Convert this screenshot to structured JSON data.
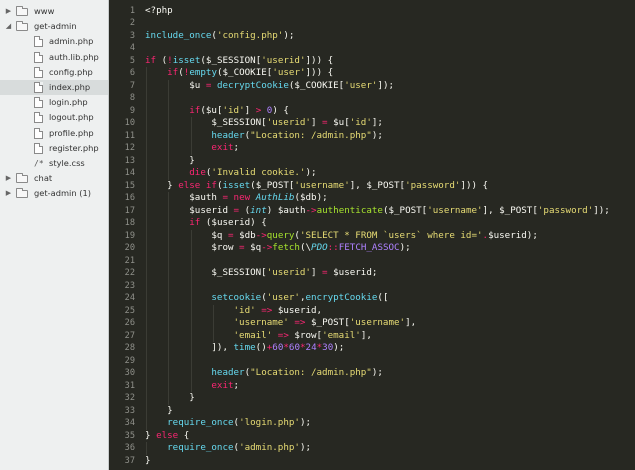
{
  "sidebar": {
    "items": [
      {
        "label": "www",
        "type": "folder",
        "expanded": false,
        "depth": 0,
        "selected": false
      },
      {
        "label": "get-admin",
        "type": "folder",
        "expanded": true,
        "depth": 0,
        "selected": false
      },
      {
        "label": "admin.php",
        "type": "file",
        "depth": 1,
        "selected": false
      },
      {
        "label": "auth.lib.php",
        "type": "file",
        "depth": 1,
        "selected": false
      },
      {
        "label": "config.php",
        "type": "file",
        "depth": 1,
        "selected": false
      },
      {
        "label": "index.php",
        "type": "file",
        "depth": 1,
        "selected": true
      },
      {
        "label": "login.php",
        "type": "file",
        "depth": 1,
        "selected": false
      },
      {
        "label": "logout.php",
        "type": "file",
        "depth": 1,
        "selected": false
      },
      {
        "label": "profile.php",
        "type": "file",
        "depth": 1,
        "selected": false
      },
      {
        "label": "register.php",
        "type": "file",
        "depth": 1,
        "selected": false
      },
      {
        "label": "style.css",
        "type": "css",
        "depth": 1,
        "selected": false
      },
      {
        "label": "chat",
        "type": "folder",
        "expanded": false,
        "depth": 0,
        "selected": false
      },
      {
        "label": "get-admin (1)",
        "type": "folder",
        "expanded": false,
        "depth": 0,
        "selected": false
      }
    ]
  },
  "editor": {
    "theme": {
      "background": "#272822",
      "sidebar_background": "#eef0f0",
      "selected_row": "#d8dcdc"
    },
    "lines": [
      [
        [
          "v",
          "<?php"
        ]
      ],
      [],
      [
        [
          "f",
          "include_once"
        ],
        [
          "v",
          "("
        ],
        [
          "s",
          "'config.php'"
        ],
        [
          "v",
          ");"
        ]
      ],
      [],
      [
        [
          "k",
          "if"
        ],
        [
          "v",
          " ("
        ],
        [
          "o",
          "!"
        ],
        [
          "f",
          "isset"
        ],
        [
          "v",
          "($_SESSION["
        ],
        [
          "s",
          "'userid'"
        ],
        [
          "v",
          "])) {"
        ]
      ],
      [
        [
          "v",
          "    "
        ],
        [
          "k",
          "if"
        ],
        [
          "v",
          "("
        ],
        [
          "o",
          "!"
        ],
        [
          "f",
          "empty"
        ],
        [
          "v",
          "($_COOKIE["
        ],
        [
          "s",
          "'user'"
        ],
        [
          "v",
          "])) {"
        ]
      ],
      [
        [
          "v",
          "        $u "
        ],
        [
          "o",
          "="
        ],
        [
          "v",
          " "
        ],
        [
          "f",
          "decryptCookie"
        ],
        [
          "v",
          "($_COOKIE["
        ],
        [
          "s",
          "'user'"
        ],
        [
          "v",
          "]);"
        ]
      ],
      [],
      [
        [
          "v",
          "        "
        ],
        [
          "k",
          "if"
        ],
        [
          "v",
          "($u["
        ],
        [
          "s",
          "'id'"
        ],
        [
          "v",
          "] "
        ],
        [
          "o",
          ">"
        ],
        [
          "v",
          " "
        ],
        [
          "n",
          "0"
        ],
        [
          "v",
          ") {"
        ]
      ],
      [
        [
          "v",
          "            $_SESSION["
        ],
        [
          "s",
          "'userid'"
        ],
        [
          "v",
          "] "
        ],
        [
          "o",
          "="
        ],
        [
          "v",
          " $u["
        ],
        [
          "s",
          "'id'"
        ],
        [
          "v",
          "];"
        ]
      ],
      [
        [
          "v",
          "            "
        ],
        [
          "f",
          "header"
        ],
        [
          "v",
          "("
        ],
        [
          "s",
          "\"Location: /admin.php\""
        ],
        [
          "v",
          ");"
        ]
      ],
      [
        [
          "v",
          "            "
        ],
        [
          "k",
          "exit"
        ],
        [
          "v",
          ";"
        ]
      ],
      [
        [
          "v",
          "        }"
        ]
      ],
      [
        [
          "v",
          "        "
        ],
        [
          "k",
          "die"
        ],
        [
          "v",
          "("
        ],
        [
          "s",
          "'Invalid cookie.'"
        ],
        [
          "v",
          ");"
        ]
      ],
      [
        [
          "v",
          "    } "
        ],
        [
          "k",
          "else if"
        ],
        [
          "v",
          "("
        ],
        [
          "f",
          "isset"
        ],
        [
          "v",
          "($_POST["
        ],
        [
          "s",
          "'username'"
        ],
        [
          "v",
          "], $_POST["
        ],
        [
          "s",
          "'password'"
        ],
        [
          "v",
          "])) {"
        ]
      ],
      [
        [
          "v",
          "        $auth "
        ],
        [
          "o",
          "="
        ],
        [
          "v",
          " "
        ],
        [
          "k",
          "new"
        ],
        [
          "v",
          " "
        ],
        [
          "i",
          "AuthLib"
        ],
        [
          "v",
          "($db);"
        ]
      ],
      [
        [
          "v",
          "        $userid "
        ],
        [
          "o",
          "="
        ],
        [
          "v",
          " ("
        ],
        [
          "i",
          "int"
        ],
        [
          "v",
          ") $auth"
        ],
        [
          "o",
          "->"
        ],
        [
          "g",
          "authenticate"
        ],
        [
          "v",
          "($_POST["
        ],
        [
          "s",
          "'username'"
        ],
        [
          "v",
          "], $_POST["
        ],
        [
          "s",
          "'password'"
        ],
        [
          "v",
          "]);"
        ]
      ],
      [
        [
          "v",
          "        "
        ],
        [
          "k",
          "if"
        ],
        [
          "v",
          " ($userid) {"
        ]
      ],
      [
        [
          "v",
          "            $q "
        ],
        [
          "o",
          "="
        ],
        [
          "v",
          " $db"
        ],
        [
          "o",
          "->"
        ],
        [
          "g",
          "query"
        ],
        [
          "v",
          "("
        ],
        [
          "s",
          "'SELECT * FROM `users` where id='"
        ],
        [
          "o",
          "."
        ],
        [
          "v",
          "$userid);"
        ]
      ],
      [
        [
          "v",
          "            $row "
        ],
        [
          "o",
          "="
        ],
        [
          "v",
          " $q"
        ],
        [
          "o",
          "->"
        ],
        [
          "g",
          "fetch"
        ],
        [
          "v",
          "(\\"
        ],
        [
          "i",
          "PDO"
        ],
        [
          "o",
          "::"
        ],
        [
          "c",
          "FETCH_ASSOC"
        ],
        [
          "v",
          ");"
        ]
      ],
      [],
      [
        [
          "v",
          "            $_SESSION["
        ],
        [
          "s",
          "'userid'"
        ],
        [
          "v",
          "] "
        ],
        [
          "o",
          "="
        ],
        [
          "v",
          " $userid;"
        ]
      ],
      [],
      [
        [
          "v",
          "            "
        ],
        [
          "f",
          "setcookie"
        ],
        [
          "v",
          "("
        ],
        [
          "s",
          "'user'"
        ],
        [
          "v",
          ","
        ],
        [
          "f",
          "encryptCookie"
        ],
        [
          "v",
          "(["
        ]
      ],
      [
        [
          "v",
          "                "
        ],
        [
          "s",
          "'id'"
        ],
        [
          "v",
          " "
        ],
        [
          "o",
          "=>"
        ],
        [
          "v",
          " $userid,"
        ]
      ],
      [
        [
          "v",
          "                "
        ],
        [
          "s",
          "'username'"
        ],
        [
          "v",
          " "
        ],
        [
          "o",
          "=>"
        ],
        [
          "v",
          " $_POST["
        ],
        [
          "s",
          "'username'"
        ],
        [
          "v",
          "],"
        ]
      ],
      [
        [
          "v",
          "                "
        ],
        [
          "s",
          "'email'"
        ],
        [
          "v",
          " "
        ],
        [
          "o",
          "=>"
        ],
        [
          "v",
          " $row["
        ],
        [
          "s",
          "'email'"
        ],
        [
          "v",
          "],"
        ]
      ],
      [
        [
          "v",
          "            ]), "
        ],
        [
          "f",
          "time"
        ],
        [
          "v",
          "()"
        ],
        [
          "o",
          "+"
        ],
        [
          "n",
          "60"
        ],
        [
          "o",
          "*"
        ],
        [
          "n",
          "60"
        ],
        [
          "o",
          "*"
        ],
        [
          "n",
          "24"
        ],
        [
          "o",
          "*"
        ],
        [
          "n",
          "30"
        ],
        [
          "v",
          ");"
        ]
      ],
      [],
      [
        [
          "v",
          "            "
        ],
        [
          "f",
          "header"
        ],
        [
          "v",
          "("
        ],
        [
          "s",
          "\"Location: /admin.php\""
        ],
        [
          "v",
          ");"
        ]
      ],
      [
        [
          "v",
          "            "
        ],
        [
          "k",
          "exit"
        ],
        [
          "v",
          ";"
        ]
      ],
      [
        [
          "v",
          "        }"
        ]
      ],
      [
        [
          "v",
          "    }"
        ]
      ],
      [
        [
          "v",
          "    "
        ],
        [
          "f",
          "require_once"
        ],
        [
          "v",
          "("
        ],
        [
          "s",
          "'login.php'"
        ],
        [
          "v",
          ");"
        ]
      ],
      [
        [
          "v",
          "} "
        ],
        [
          "k",
          "else"
        ],
        [
          "v",
          " {"
        ]
      ],
      [
        [
          "v",
          "    "
        ],
        [
          "f",
          "require_once"
        ],
        [
          "v",
          "("
        ],
        [
          "s",
          "'admin.php'"
        ],
        [
          "v",
          ");"
        ]
      ],
      [
        [
          "v",
          "}"
        ]
      ]
    ]
  }
}
